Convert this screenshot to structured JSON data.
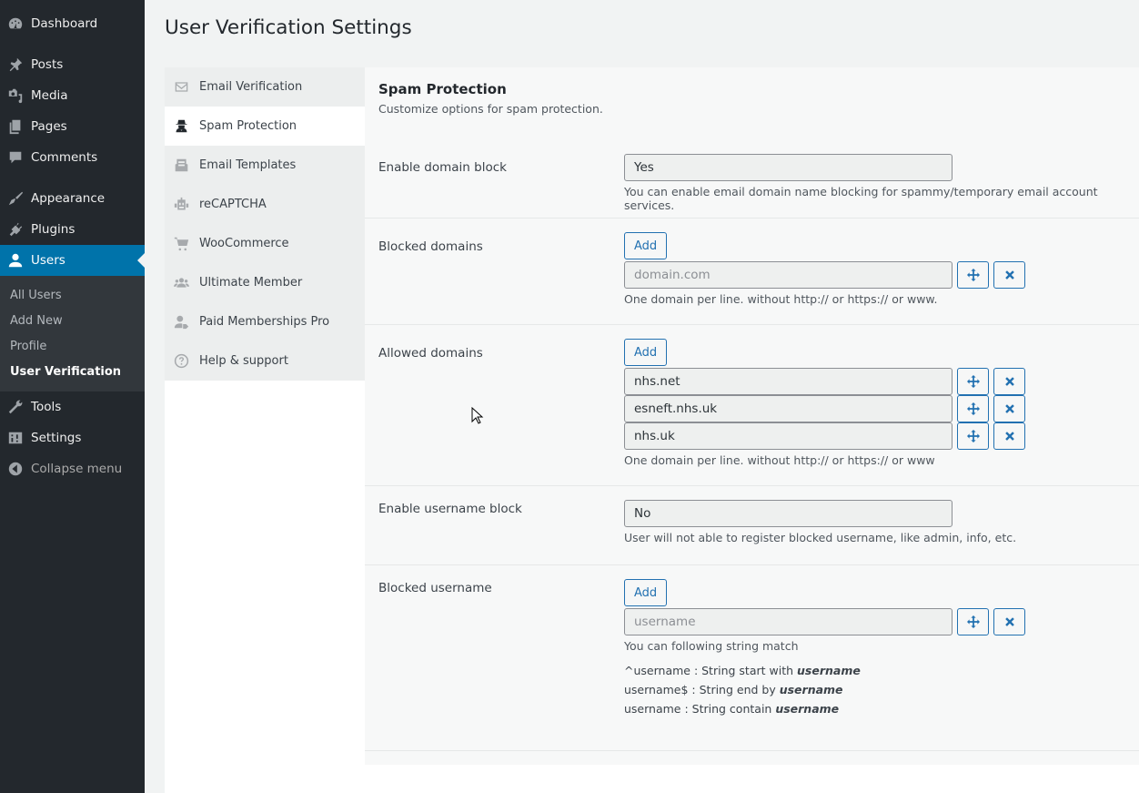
{
  "admin_menu": {
    "items": [
      {
        "label": "Dashboard",
        "icon": "dashboard-icon"
      },
      {
        "label": "Posts",
        "icon": "pin-icon"
      },
      {
        "label": "Media",
        "icon": "media-icon"
      },
      {
        "label": "Pages",
        "icon": "pages-icon"
      },
      {
        "label": "Comments",
        "icon": "comment-icon"
      },
      {
        "label": "Appearance",
        "icon": "paintbrush-icon"
      },
      {
        "label": "Plugins",
        "icon": "plugin-icon"
      },
      {
        "label": "Users",
        "icon": "user-icon",
        "current": true
      },
      {
        "label": "Tools",
        "icon": "wrench-icon"
      },
      {
        "label": "Settings",
        "icon": "settings-icon"
      },
      {
        "label": "Collapse menu",
        "icon": "collapse-icon"
      }
    ],
    "users_submenu": [
      "All Users",
      "Add New",
      "Profile",
      "User Verification"
    ],
    "accent": "#0073aa"
  },
  "page": {
    "title": "User Verification Settings"
  },
  "settings_nav": [
    {
      "label": "Email Verification",
      "icon": "envelope-icon"
    },
    {
      "label": "Spam Protection",
      "icon": "user-secret-icon",
      "active": true
    },
    {
      "label": "Email Templates",
      "icon": "email-template-icon"
    },
    {
      "label": "reCAPTCHA",
      "icon": "robot-icon"
    },
    {
      "label": "WooCommerce",
      "icon": "cart-icon"
    },
    {
      "label": "Ultimate Member",
      "icon": "users-group-icon"
    },
    {
      "label": "Paid Memberships Pro",
      "icon": "user-tag-icon"
    },
    {
      "label": "Help & support",
      "icon": "question-circle-icon"
    }
  ],
  "panel": {
    "title": "Spam Protection",
    "subtitle": "Customize options for spam protection.",
    "enable_domain_block": {
      "label": "Enable domain block",
      "value": "Yes",
      "description": "You can enable email domain name blocking for spammy/temporary email account services."
    },
    "blocked_domains": {
      "label": "Blocked domains",
      "add_label": "Add",
      "placeholder": "domain.com",
      "values": [
        ""
      ],
      "description": "One domain per line. without http:// or https:// or www."
    },
    "allowed_domains": {
      "label": "Allowed domains",
      "add_label": "Add",
      "values": [
        "nhs.net",
        "esneft.nhs.uk",
        "nhs.uk"
      ],
      "description": "One domain per line. without http:// or https:// or www"
    },
    "enable_username_block": {
      "label": "Enable username block",
      "value": "No",
      "description": "User will not able to register blocked username, like admin, info, etc."
    },
    "blocked_username": {
      "label": "Blocked username",
      "add_label": "Add",
      "placeholder": "username",
      "description": "You can following string match",
      "hints": [
        {
          "pattern": "^username",
          "text": " : String start with ",
          "emph": "username"
        },
        {
          "pattern": "username$",
          "text": " : String end by ",
          "emph": "username"
        },
        {
          "pattern": "username",
          "text": " : String contain ",
          "emph": "username"
        }
      ]
    }
  }
}
